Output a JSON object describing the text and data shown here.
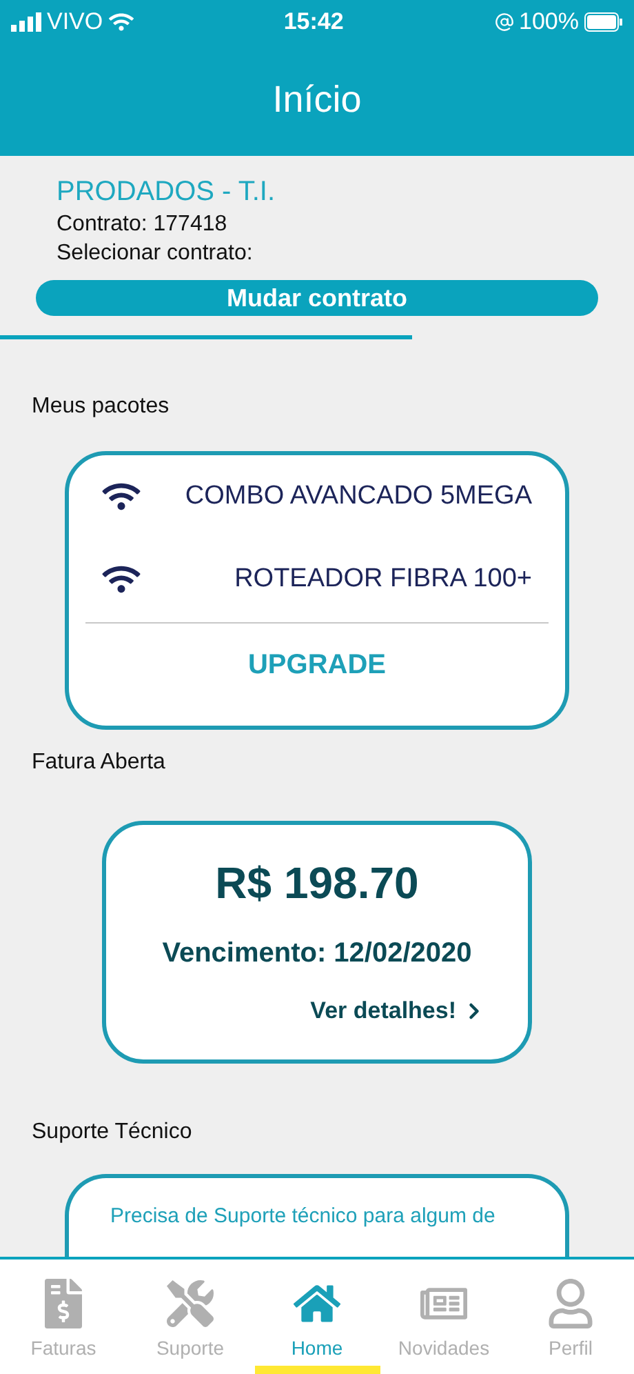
{
  "status_bar": {
    "carrier": "VIVO",
    "time": "15:42",
    "battery": "100%"
  },
  "header": {
    "title": "Início"
  },
  "contract": {
    "company": "PRODADOS - T.I.",
    "number": "Contrato: 177418",
    "select_label": "Selecionar contrato:",
    "button": "Mudar contrato"
  },
  "packages": {
    "title": "Meus pacotes",
    "items": [
      {
        "name": "COMBO AVANCADO 5MEGA"
      },
      {
        "name": "ROTEADOR FIBRA 100+"
      }
    ],
    "upgrade": "UPGRADE"
  },
  "invoice": {
    "title": "Fatura Aberta",
    "amount": "R$ 198.70",
    "due": "Vencimento: 12/02/2020",
    "details": "Ver detalhes!"
  },
  "support": {
    "title": "Suporte Técnico",
    "text": "Precisa de Suporte técnico para algum de"
  },
  "tabs": [
    {
      "kind": "invoice",
      "label": "Faturas",
      "selected": false
    },
    {
      "kind": "tools",
      "label": "Suporte",
      "selected": false
    },
    {
      "kind": "home",
      "label": "Home",
      "selected": true
    },
    {
      "kind": "news",
      "label": "Novidades",
      "selected": false
    },
    {
      "kind": "profile",
      "label": "Perfil",
      "selected": false
    }
  ]
}
